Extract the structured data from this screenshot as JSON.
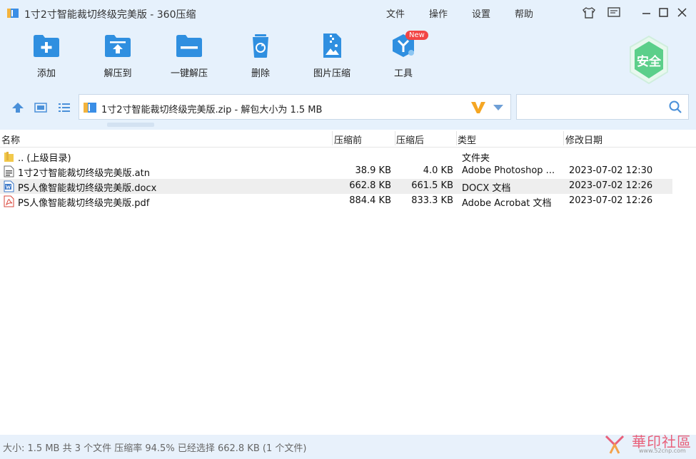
{
  "window": {
    "title": "1寸2寸智能裁切终级完美版 - 360压缩",
    "menu": [
      "文件",
      "操作",
      "设置",
      "帮助"
    ]
  },
  "toolbar": {
    "items": [
      {
        "label": "添加",
        "icon": "add-icon"
      },
      {
        "label": "解压到",
        "icon": "extract-icon"
      },
      {
        "label": "一键解压",
        "icon": "one-click-extract-icon"
      },
      {
        "label": "删除",
        "icon": "delete-icon"
      },
      {
        "label": "图片压缩",
        "icon": "image-compress-icon"
      },
      {
        "label": "工具",
        "icon": "tools-icon"
      }
    ],
    "new_badge": "New",
    "safe_label": "安全"
  },
  "address": {
    "text": "1寸2寸智能裁切终级完美版.zip - 解包大小为 1.5 MB"
  },
  "search": {
    "value": "",
    "placeholder": ""
  },
  "table": {
    "headers": [
      "名称",
      "压缩前",
      "压缩后",
      "类型",
      "修改日期"
    ],
    "rows": [
      {
        "name": ".. (上级目录)",
        "before": "",
        "after": "",
        "type": "文件夹",
        "date": "",
        "icon": "folder-icon"
      },
      {
        "name": "1寸2寸智能裁切终级完美版.atn",
        "before": "38.9 KB",
        "after": "4.0 KB",
        "type": "Adobe Photoshop ...",
        "date": "2023-07-02 12:30",
        "icon": "atn-file-icon"
      },
      {
        "name": "PS人像智能裁切终级完美版.docx",
        "before": "662.8 KB",
        "after": "661.5 KB",
        "type": "DOCX 文档",
        "date": "2023-07-02 12:26",
        "icon": "docx-file-icon"
      },
      {
        "name": "PS人像智能裁切终级完美版.pdf",
        "before": "884.4 KB",
        "after": "833.3 KB",
        "type": "Adobe Acrobat 文档",
        "date": "2023-07-02 12:26",
        "icon": "pdf-file-icon"
      }
    ]
  },
  "status": {
    "text": "大小: 1.5 MB 共 3 个文件 压缩率 94.5% 已经选择 662.8 KB (1 个文件)"
  },
  "watermark": {
    "main": "華印社區",
    "sub": "www.52cnp.com"
  },
  "colors": {
    "accent": "#2f8fe0",
    "safe": "#5ccf8a",
    "badge": "#f24545"
  }
}
